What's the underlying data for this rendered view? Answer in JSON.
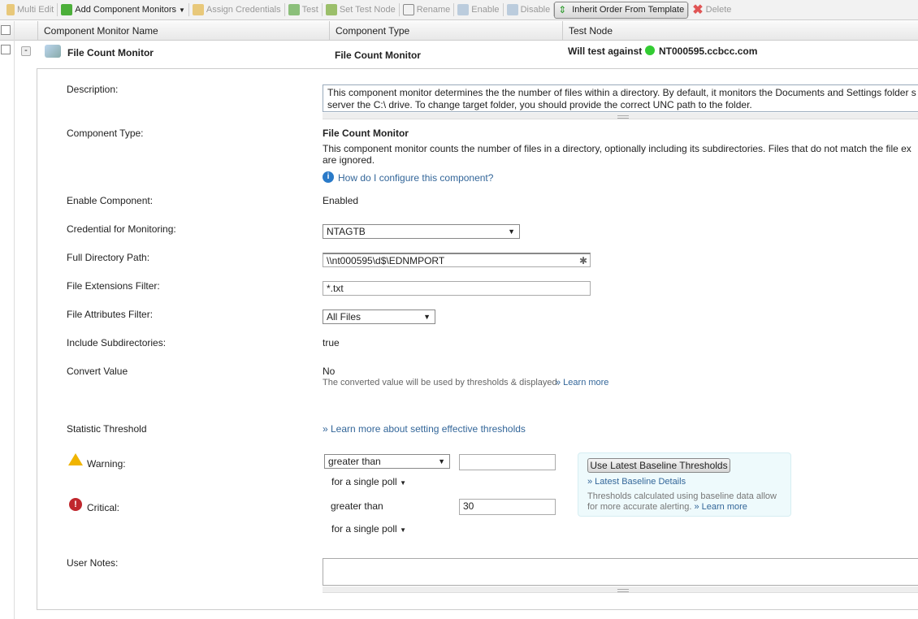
{
  "toolbar": {
    "multi_edit": "Multi Edit",
    "add": "Add Component Monitors",
    "assign": "Assign Credentials",
    "test": "Test",
    "set_node": "Set Test Node",
    "rename": "Rename",
    "enable": "Enable",
    "disable": "Disable",
    "inherit": "Inherit Order From Template",
    "delete": "Delete"
  },
  "grid": {
    "headers": [
      "Component Monitor Name",
      "Component Type",
      "Test Node"
    ],
    "row": {
      "name": "File Count Monitor",
      "type": "File Count Monitor",
      "test_prefix": "Will test against",
      "node": "NT000595.ccbcc.com",
      "node_status_color": "#33cc33"
    }
  },
  "form": {
    "description": {
      "label": "Description:",
      "value": "This component monitor determines the the number of files within a directory. By default, it monitors the Documents and Settings folder s",
      "value2": "server the C:\\ drive. To change target folder, you should provide the correct UNC path to the folder."
    },
    "component_type": {
      "label": "Component Type:",
      "title": "File Count Monitor",
      "desc": "This component monitor counts the number of files in a directory, optionally including its subdirectories. Files that do not match the file ex",
      "desc2": "are ignored.",
      "help": "How do I configure this component?"
    },
    "enable": {
      "label": "Enable Component:",
      "value": "Enabled"
    },
    "credential": {
      "label": "Credential for Monitoring:",
      "value": "NTAGTB"
    },
    "path": {
      "label": "Full Directory Path:",
      "value": "\\\\nt000595\\d$\\EDNMPORT"
    },
    "extensions": {
      "label": "File Extensions Filter:",
      "value": "*.txt"
    },
    "attributes": {
      "label": "File Attributes Filter:",
      "value": "All Files"
    },
    "subdirs": {
      "label": "Include Subdirectories:",
      "value": "true"
    },
    "convert": {
      "label": "Convert Value",
      "value": "No",
      "note": "The converted value will be used by thresholds & displayed.",
      "link": "» Learn more"
    },
    "statistic": {
      "label": "Statistic Threshold",
      "link": "» Learn more about setting effective thresholds"
    },
    "warning": {
      "label": "Warning:",
      "operator": "greater than",
      "value": "",
      "poll": "for a single poll"
    },
    "critical": {
      "label": "Critical:",
      "operator": "greater than",
      "value": "30",
      "poll": "for a single poll"
    },
    "baseline": {
      "button": "Use Latest Baseline Thresholds",
      "details": "» Latest Baseline Details",
      "text1": "Thresholds calculated using baseline data allow",
      "text2": "for more accurate alerting.",
      "learn": "» Learn more"
    },
    "notes": {
      "label": "User Notes:",
      "value": ""
    }
  }
}
